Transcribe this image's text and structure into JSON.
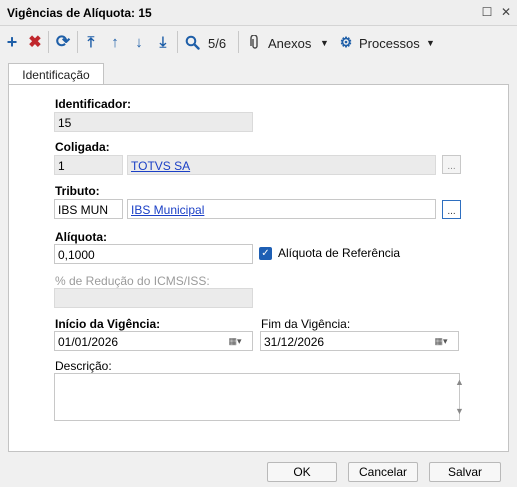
{
  "window": {
    "title": "Vigências de Alíquota: 15"
  },
  "toolbar": {
    "record_counter": "5/6",
    "anexos_label": "Anexos",
    "processos_label": "Processos"
  },
  "tabs": [
    {
      "label": "Identificação"
    }
  ],
  "form": {
    "identificador": {
      "label": "Identificador:",
      "value": "15"
    },
    "coligada": {
      "label": "Coligada:",
      "code": "1",
      "name": "TOTVS SA"
    },
    "tributo": {
      "label": "Tributo:",
      "code": "IBS MUN",
      "name": "IBS Municipal"
    },
    "aliquota": {
      "label": "Alíquota:",
      "value": "0,1000"
    },
    "aliquota_referencia": {
      "label": "Alíquota de Referência",
      "checked": true
    },
    "reducao": {
      "label": "% de Redução do ICMS/ISS:",
      "value": ""
    },
    "inicio_vigencia": {
      "label": "Início da Vigência:",
      "value": "01/01/2026"
    },
    "fim_vigencia": {
      "label": "Fim da Vigência:",
      "value": "31/12/2026"
    },
    "descricao": {
      "label": "Descrição:",
      "value": ""
    }
  },
  "footer": {
    "ok_label": "OK",
    "cancel_label": "Cancelar",
    "save_label": "Salvar"
  },
  "colors": {
    "accent": "#1f5fa8",
    "delete": "#c0272d",
    "link": "#1a3fc6",
    "checkbox": "#1e5fb4"
  }
}
